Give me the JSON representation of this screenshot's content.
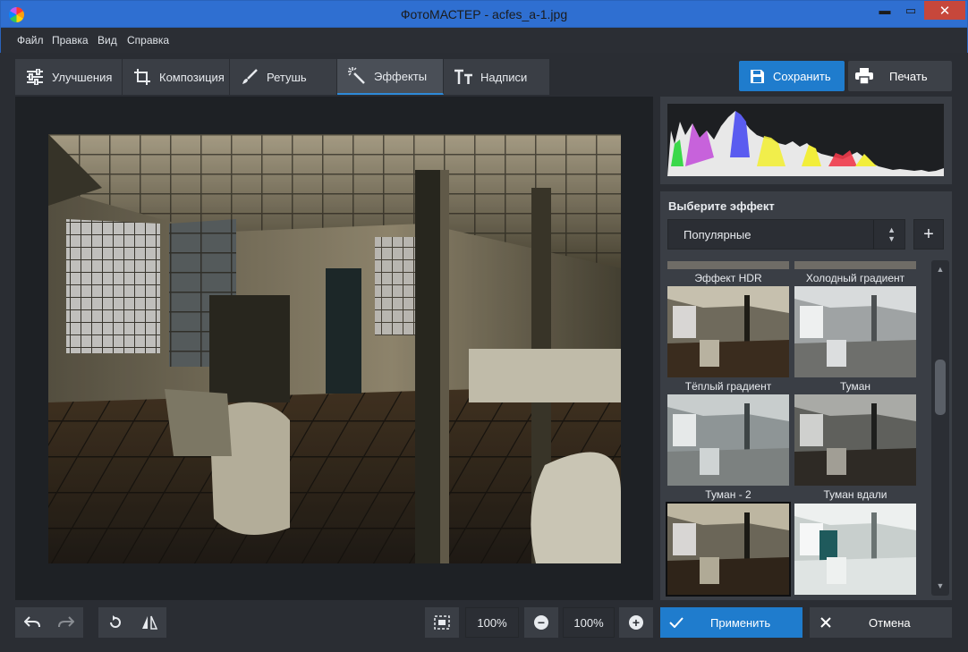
{
  "window": {
    "title": "ФотоМАСТЕР - acfes_a-1.jpg",
    "min_glyph": "▬",
    "max_glyph": "▭",
    "close_glyph": "✕"
  },
  "menu": [
    "Файл",
    "Правка",
    "Вид",
    "Справка"
  ],
  "tabs": [
    {
      "label": "Улучшения",
      "icon": "sliders-icon"
    },
    {
      "label": "Композиция",
      "icon": "crop-icon"
    },
    {
      "label": "Ретушь",
      "icon": "brush-icon"
    },
    {
      "label": "Эффекты",
      "icon": "magic-wand-icon",
      "active": true
    },
    {
      "label": "Надписи",
      "icon": "text-icon"
    }
  ],
  "toolbar": {
    "save_label": "Сохранить",
    "print_label": "Печать"
  },
  "effects": {
    "title": "Выберите эффект",
    "category": "Популярные",
    "add_glyph": "+",
    "items": [
      {
        "label": "Эффект HDR",
        "style": "hdr"
      },
      {
        "label": "Холодный градиент",
        "style": "cold"
      },
      {
        "label": "Тёплый градиент",
        "style": "warm"
      },
      {
        "label": "Туман",
        "style": "fog"
      },
      {
        "label": "Туман - 2",
        "style": "fog2",
        "selected": true
      },
      {
        "label": "Туман вдали",
        "style": "fogfar"
      }
    ]
  },
  "zoom": {
    "fit_value": "100%",
    "current_value": "100%",
    "minus": "−",
    "plus": "+"
  },
  "actions": {
    "apply_label": "Применить",
    "cancel_label": "Отмена"
  },
  "colors": {
    "accent": "#1f7ccd",
    "titlebar": "#2f6fd1",
    "panel": "#3a3e45",
    "background": "#2a2d33"
  }
}
